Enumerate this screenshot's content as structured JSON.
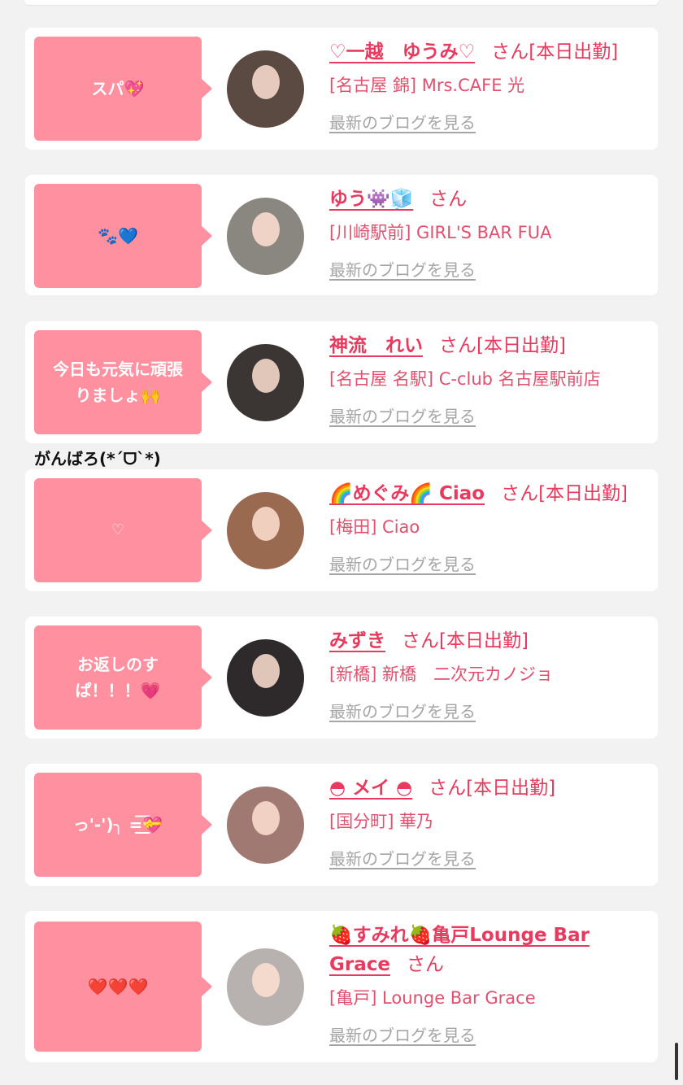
{
  "cards": [
    {
      "bubble": "スパ💖",
      "name": "♡一越　ゆうみ♡",
      "san": "さん",
      "status": "[本日出勤]",
      "shop": "[名古屋 錦] Mrs.CAFE 光",
      "blog": "最新のブログを見る",
      "avatar_color": "#5a4a42"
    },
    {
      "bubble": "🐾💙",
      "name": "ゆう👾🧊",
      "san": "さん",
      "status": "",
      "shop": "[川崎駅前] GIRL'S BAR FUA",
      "blog": "最新のブログを見る",
      "avatar_color": "#8a8680"
    },
    {
      "bubble": "今日も元気に頑張\nりましょ🙌",
      "name": "神流　れい",
      "san": "さん",
      "status": "[本日出勤]",
      "shop": "[名古屋 名駅] C-club 名古屋駅前店",
      "blog": "最新のブログを見る",
      "overflow_text": "がんばろ(*´ᗜ`*)",
      "avatar_color": "#3b3533"
    },
    {
      "bubble": "♡",
      "name": "🌈めぐみ🌈 Ciao",
      "san": "さん",
      "status": "[本日出勤]",
      "shop": "[梅田] Ciao",
      "blog": "最新のブログを見る",
      "avatar_color": "#9a6a50"
    },
    {
      "bubble": "お返しのす\nぱ！！！💗",
      "name": "みずき",
      "san": "さん",
      "status": "[本日出勤]",
      "shop": "[新橋] 新橋　二次元カノジョ",
      "blog": "最新のブログを見る",
      "avatar_color": "#2e2a2c"
    },
    {
      "bubble": "っ'-')╮ =͟͟͞͞💝",
      "name": "◓ メイ ◓",
      "san": "さん",
      "status": "[本日出勤]",
      "shop": "[国分町] 華乃",
      "blog": "最新のブログを見る",
      "avatar_color": "#a07a72"
    },
    {
      "bubble": "❤️❤️❤️",
      "name": "🍓すみれ🍓亀戸Lounge Bar Grace",
      "san": "さん",
      "status": "",
      "shop": "[亀戸] Lounge Bar Grace",
      "blog": "最新のブログを見る",
      "avatar_color": "#b7b2b0"
    }
  ]
}
